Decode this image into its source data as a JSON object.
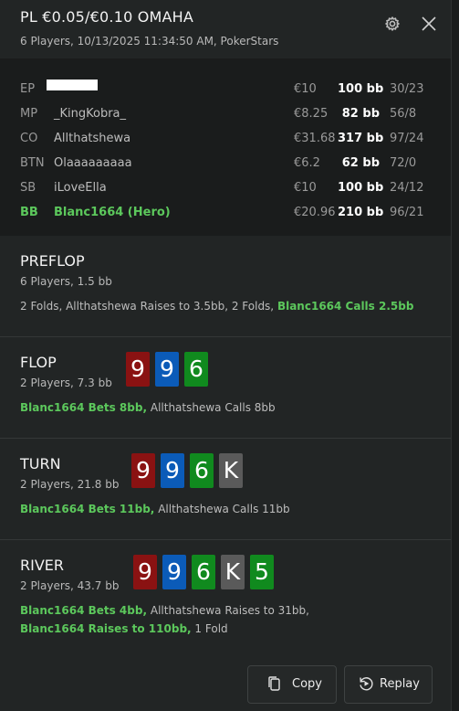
{
  "header": {
    "title": "PL €0.05/€0.10 OMAHA",
    "subtitle": "6 Players, 10/13/2025 11:34:50 AM, PokerStars"
  },
  "players": [
    {
      "pos": "EP",
      "name": "",
      "stack": "€10",
      "bb": "100 bb",
      "stats": "30/23"
    },
    {
      "pos": "MP",
      "name": "_KingKobra_",
      "stack": "€8.25",
      "bb": "82 bb",
      "stats": "56/8"
    },
    {
      "pos": "CO",
      "name": "Allthatshewa",
      "stack": "€31.68",
      "bb": "317 bb",
      "stats": "97/24"
    },
    {
      "pos": "BTN",
      "name": "Olaaaaaaaaa",
      "stack": "€6.2",
      "bb": "62 bb",
      "stats": "72/0"
    },
    {
      "pos": "SB",
      "name": "iLoveElla",
      "stack": "€10",
      "bb": "100 bb",
      "stats": "24/12"
    },
    {
      "pos": "BB",
      "name": "Blanc1664 (Hero)",
      "stack": "€20.96",
      "bb": "210 bb",
      "stats": "96/21"
    }
  ],
  "preflop": {
    "name": "PREFLOP",
    "info": "6 Players, 1.5 bb",
    "a1": "2 Folds, Allthatshewa Raises to 3.5bb, 2 Folds,",
    "a2": "Blanc1664 Calls 2.5bb"
  },
  "flop": {
    "name": "FLOP",
    "info": "2 Players, 7.3 bb",
    "cards": [
      "9",
      "9",
      "6"
    ],
    "a1": "Blanc1664 Bets 8bb,",
    "a2": "Allthatshewa Calls 8bb"
  },
  "turn": {
    "name": "TURN",
    "info": "2 Players, 21.8 bb",
    "cards": [
      "9",
      "9",
      "6",
      "K"
    ],
    "a1": "Blanc1664 Bets 11bb,",
    "a2": "Allthatshewa Calls 11bb"
  },
  "river": {
    "name": "RIVER",
    "info": "2 Players, 43.7 bb",
    "cards": [
      "9",
      "9",
      "6",
      "K",
      "5"
    ],
    "a1": "Blanc1664 Bets 4bb,",
    "a2": "Allthatshewa Raises to 31bb,",
    "a3": "Blanc1664 Raises to 110bb,",
    "a4": "1 Fold"
  },
  "buttons": {
    "copy": "Copy",
    "replay": "Replay"
  },
  "colors": {
    "hero_green": "#5cc85c",
    "card_red": "#8a1212",
    "card_blue": "#0b5bb8",
    "card_green": "#108a1e",
    "card_grey": "#5a5a5a"
  },
  "icons": {
    "settings": "gear-icon",
    "close": "close-icon",
    "copy": "copy-icon",
    "replay": "replay-icon"
  }
}
